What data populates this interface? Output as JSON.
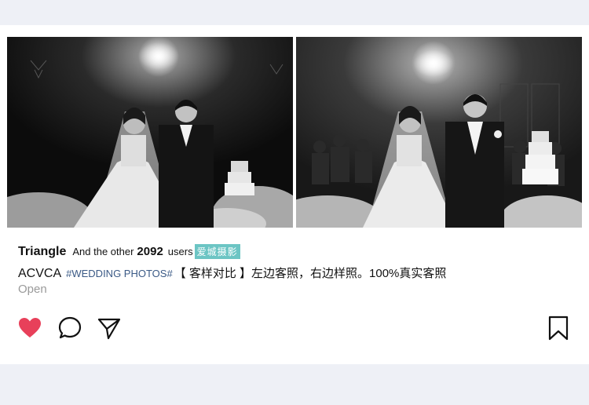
{
  "post": {
    "username": "Triangle",
    "likes_prefix": "And the other",
    "likes_count": "2092",
    "likes_suffix": "users",
    "brand_tag": "爱城摄影",
    "caption_account": "ACVCA",
    "caption_hashtag": "#WEDDING PHOTOS#",
    "caption_text": "【 客样对比 】左边客照，右边样照。100%真实客照",
    "open_label": "Open"
  },
  "photos": [
    {
      "name": "customer-photo",
      "description_icon": "wedding-couple-image"
    },
    {
      "name": "sample-photo",
      "description_icon": "wedding-couple-image"
    }
  ],
  "actions": {
    "like_icon": "heart-icon",
    "comment_icon": "comment-icon",
    "share_icon": "send-icon",
    "save_icon": "bookmark-icon"
  },
  "colors": {
    "page_bg": "#eef0f6",
    "card_bg": "#ffffff",
    "heart": "#e8405a",
    "hashtag": "#3b5a86",
    "brand_tag_bg": "#6cc5c4",
    "open_text": "#9a9a9a"
  }
}
